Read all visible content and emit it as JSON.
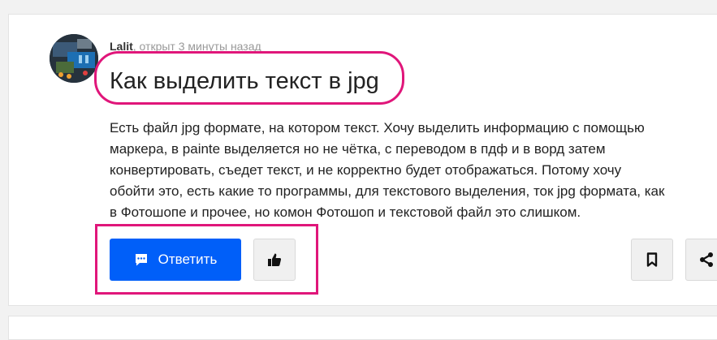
{
  "question": {
    "author": "Lalit",
    "opened_text": ", открыт 3 минуты назад",
    "title": "Как выделить текст в jpg",
    "body_lines": [
      "Есть файл jpg формате, на котором текст. Хочу выделить информацию с помощью",
      "маркера, в painte выделяется но не чётка, с переводом в пдф и в ворд затем",
      "конвертировать, съедет текст, и не корректно будет отображаться. Потому хочу",
      "обойти это, есть какие то программы, для текстового выделения, ток jpg формата, как",
      "в Фотошопе и прочее, но комон Фотошоп и текстовой файл это слишком."
    ]
  },
  "actions": {
    "reply_label": "Ответить",
    "reply_icon": "chat-icon",
    "like_icon": "thumbs-up-icon",
    "bookmark_icon": "bookmark-icon",
    "share_icon": "share-icon"
  },
  "colors": {
    "accent": "#005ff9",
    "annotation": "#e0167a"
  }
}
